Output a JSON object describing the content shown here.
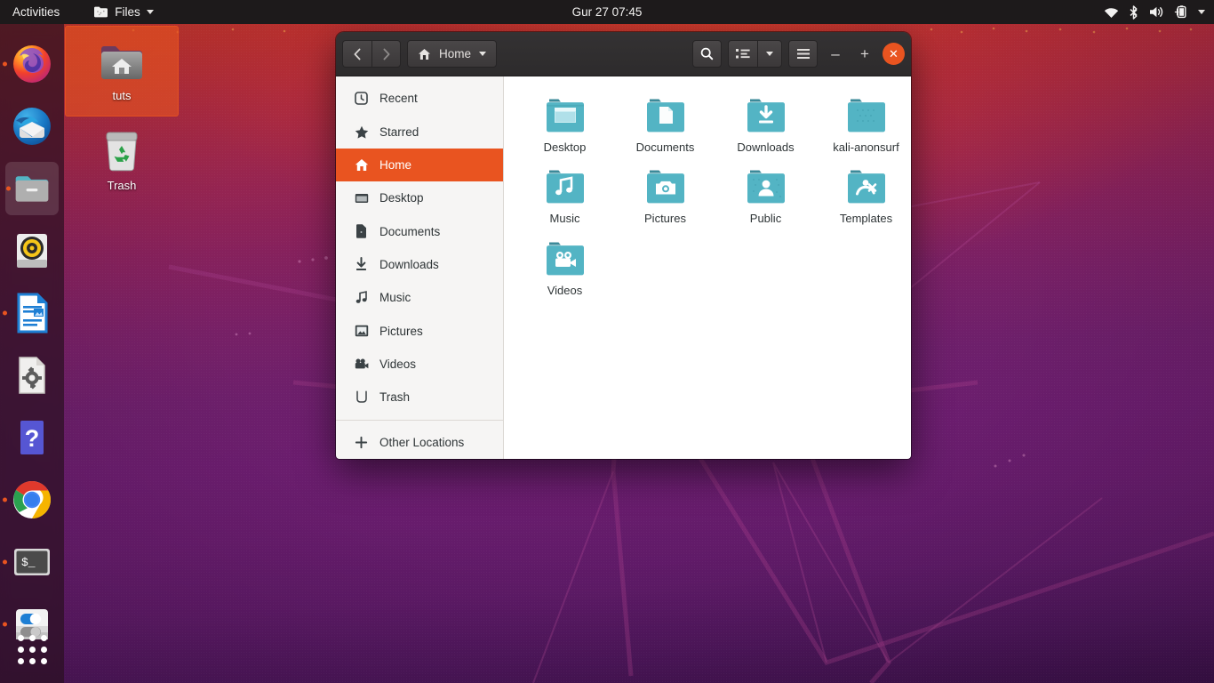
{
  "topbar": {
    "activities": "Activities",
    "app_name": "Files",
    "clock": "Gur 27  07:45",
    "tray": [
      {
        "name": "wifi-icon"
      },
      {
        "name": "bluetooth-icon"
      },
      {
        "name": "volume-icon"
      },
      {
        "name": "battery-charging-icon"
      },
      {
        "name": "chevron-down-icon"
      }
    ]
  },
  "dock": {
    "items": [
      {
        "label": "Firefox",
        "icon": "firefox-icon",
        "running": false
      },
      {
        "label": "Thunderbird Mail",
        "icon": "thunderbird-icon",
        "running": false
      },
      {
        "label": "Files",
        "icon": "files-icon",
        "running": true
      },
      {
        "label": "Rhythmbox",
        "icon": "rhythmbox-icon",
        "running": false
      },
      {
        "label": "LibreOffice Writer",
        "icon": "libreoffice-writer-icon",
        "running": true
      },
      {
        "label": "Ubuntu Software",
        "icon": "software-install-icon",
        "running": false
      },
      {
        "label": "Help",
        "icon": "help-icon",
        "running": false
      },
      {
        "label": "Google Chrome",
        "icon": "chrome-icon",
        "running": true
      },
      {
        "label": "Terminal",
        "icon": "terminal-icon",
        "running": true
      },
      {
        "label": "Settings",
        "icon": "settings-icon",
        "running": true
      }
    ],
    "show_applications": "Show Applications"
  },
  "desktop": {
    "icons": [
      {
        "label": "tuts",
        "icon": "folder-home-icon",
        "selected": true
      },
      {
        "label": "Trash",
        "icon": "trash-icon",
        "selected": false
      }
    ]
  },
  "window": {
    "title": "Home",
    "nav": {
      "back": "Back",
      "forward": "Forward"
    },
    "path_label": "Home",
    "buttons": {
      "search": "Search",
      "view_list": "List view",
      "view_options": "View options",
      "menu": "Main menu",
      "minimize": "–",
      "maximize": "+",
      "close": "✕"
    },
    "sidebar": {
      "items": [
        {
          "label": "Recent",
          "icon": "clock-icon",
          "active": false
        },
        {
          "label": "Starred",
          "icon": "star-icon",
          "active": false
        },
        {
          "label": "Home",
          "icon": "home-icon",
          "active": true
        },
        {
          "label": "Desktop",
          "icon": "desktop-icon",
          "active": false
        },
        {
          "label": "Documents",
          "icon": "document-icon",
          "active": false
        },
        {
          "label": "Downloads",
          "icon": "download-icon",
          "active": false
        },
        {
          "label": "Music",
          "icon": "music-note-icon",
          "active": false
        },
        {
          "label": "Pictures",
          "icon": "picture-icon",
          "active": false
        },
        {
          "label": "Videos",
          "icon": "video-camera-icon",
          "active": false
        },
        {
          "label": "Trash",
          "icon": "trash-icon",
          "active": false
        }
      ],
      "other_locations": "Other Locations",
      "other_locations_icon": "plus-icon"
    },
    "files": [
      {
        "name": "Desktop",
        "icon": "folder-desktop-icon"
      },
      {
        "name": "Documents",
        "icon": "folder-documents-icon"
      },
      {
        "name": "Downloads",
        "icon": "folder-downloads-icon"
      },
      {
        "name": "kali-anonsurf",
        "icon": "folder-icon"
      },
      {
        "name": "Music",
        "icon": "folder-music-icon"
      },
      {
        "name": "Pictures",
        "icon": "folder-pictures-icon"
      },
      {
        "name": "Public",
        "icon": "folder-public-icon"
      },
      {
        "name": "Templates",
        "icon": "folder-templates-icon"
      },
      {
        "name": "Videos",
        "icon": "folder-videos-icon"
      }
    ]
  },
  "colors": {
    "accent": "#e95420",
    "topbar_bg": "#1d1a1b",
    "headerbar_bg": "#2d2b2c",
    "sidebar_bg": "#f6f5f4",
    "folder_teal": "#53b4c4"
  }
}
